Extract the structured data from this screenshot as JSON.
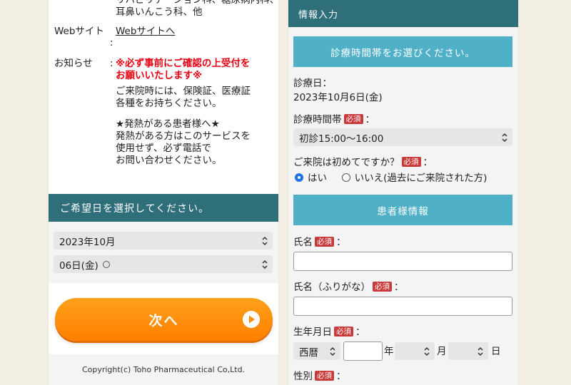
{
  "left_panel": {
    "info": {
      "departments_cut": "リハビリテーション科、糖尿病内科、",
      "departments_last": "耳鼻いんこう科、他",
      "website_label": "Webサイト",
      "website_colon": ":",
      "website_link": "Webサイトへ",
      "notice_label": "お知らせ",
      "notice_colon": ":",
      "notice_red_1": "※必ず事前にご確認の上受付を",
      "notice_red_2": "お願いいたします※",
      "notice_1": "ご来院時には、保険証、医療証",
      "notice_2": "各種をお持ちください。",
      "notice_3": "★発熱がある患者様へ★",
      "notice_4": "発熱がある方はこのサービスを",
      "notice_5": "使用せず、必ず電話で",
      "notice_6": "お問い合わせください。"
    },
    "date_header": "ご希望日を選択してください。",
    "month_select": "2023年10月",
    "day_select": "06日(金)",
    "next_button": "次へ",
    "footer": "Copyright(c) Toho Pharmaceutical Co,Ltd."
  },
  "right_panel": {
    "header": "情報入力",
    "time_section_bar": "診療時間帯をお選びください。",
    "date_label": "診療日：",
    "date_value": "2023年10月6日(金)",
    "time_label": "診療時間帯",
    "required": "必須",
    "colon": "：",
    "time_select": "初診15:00～16:00",
    "first_visit_question": "ご来院は初めてですか？",
    "radio_yes": "はい",
    "radio_no": "いいえ(過去にご来院された方)",
    "patient_section_bar": "患者様情報",
    "name_label": "氏名",
    "kana_label": "氏名（ふりがな）",
    "birth_label": "生年月日",
    "era_select": "西暦",
    "year_unit": "年",
    "month_unit": "月",
    "day_unit": "日",
    "gender_label": "性別"
  },
  "colors": {
    "header_teal": "#2f6f7a",
    "bar_cyan": "#4fb0c8",
    "next_orange": "#ff8c00",
    "required_red": "#c83a3a",
    "notice_red": "#e60012",
    "radio_blue": "#1a73e8"
  }
}
